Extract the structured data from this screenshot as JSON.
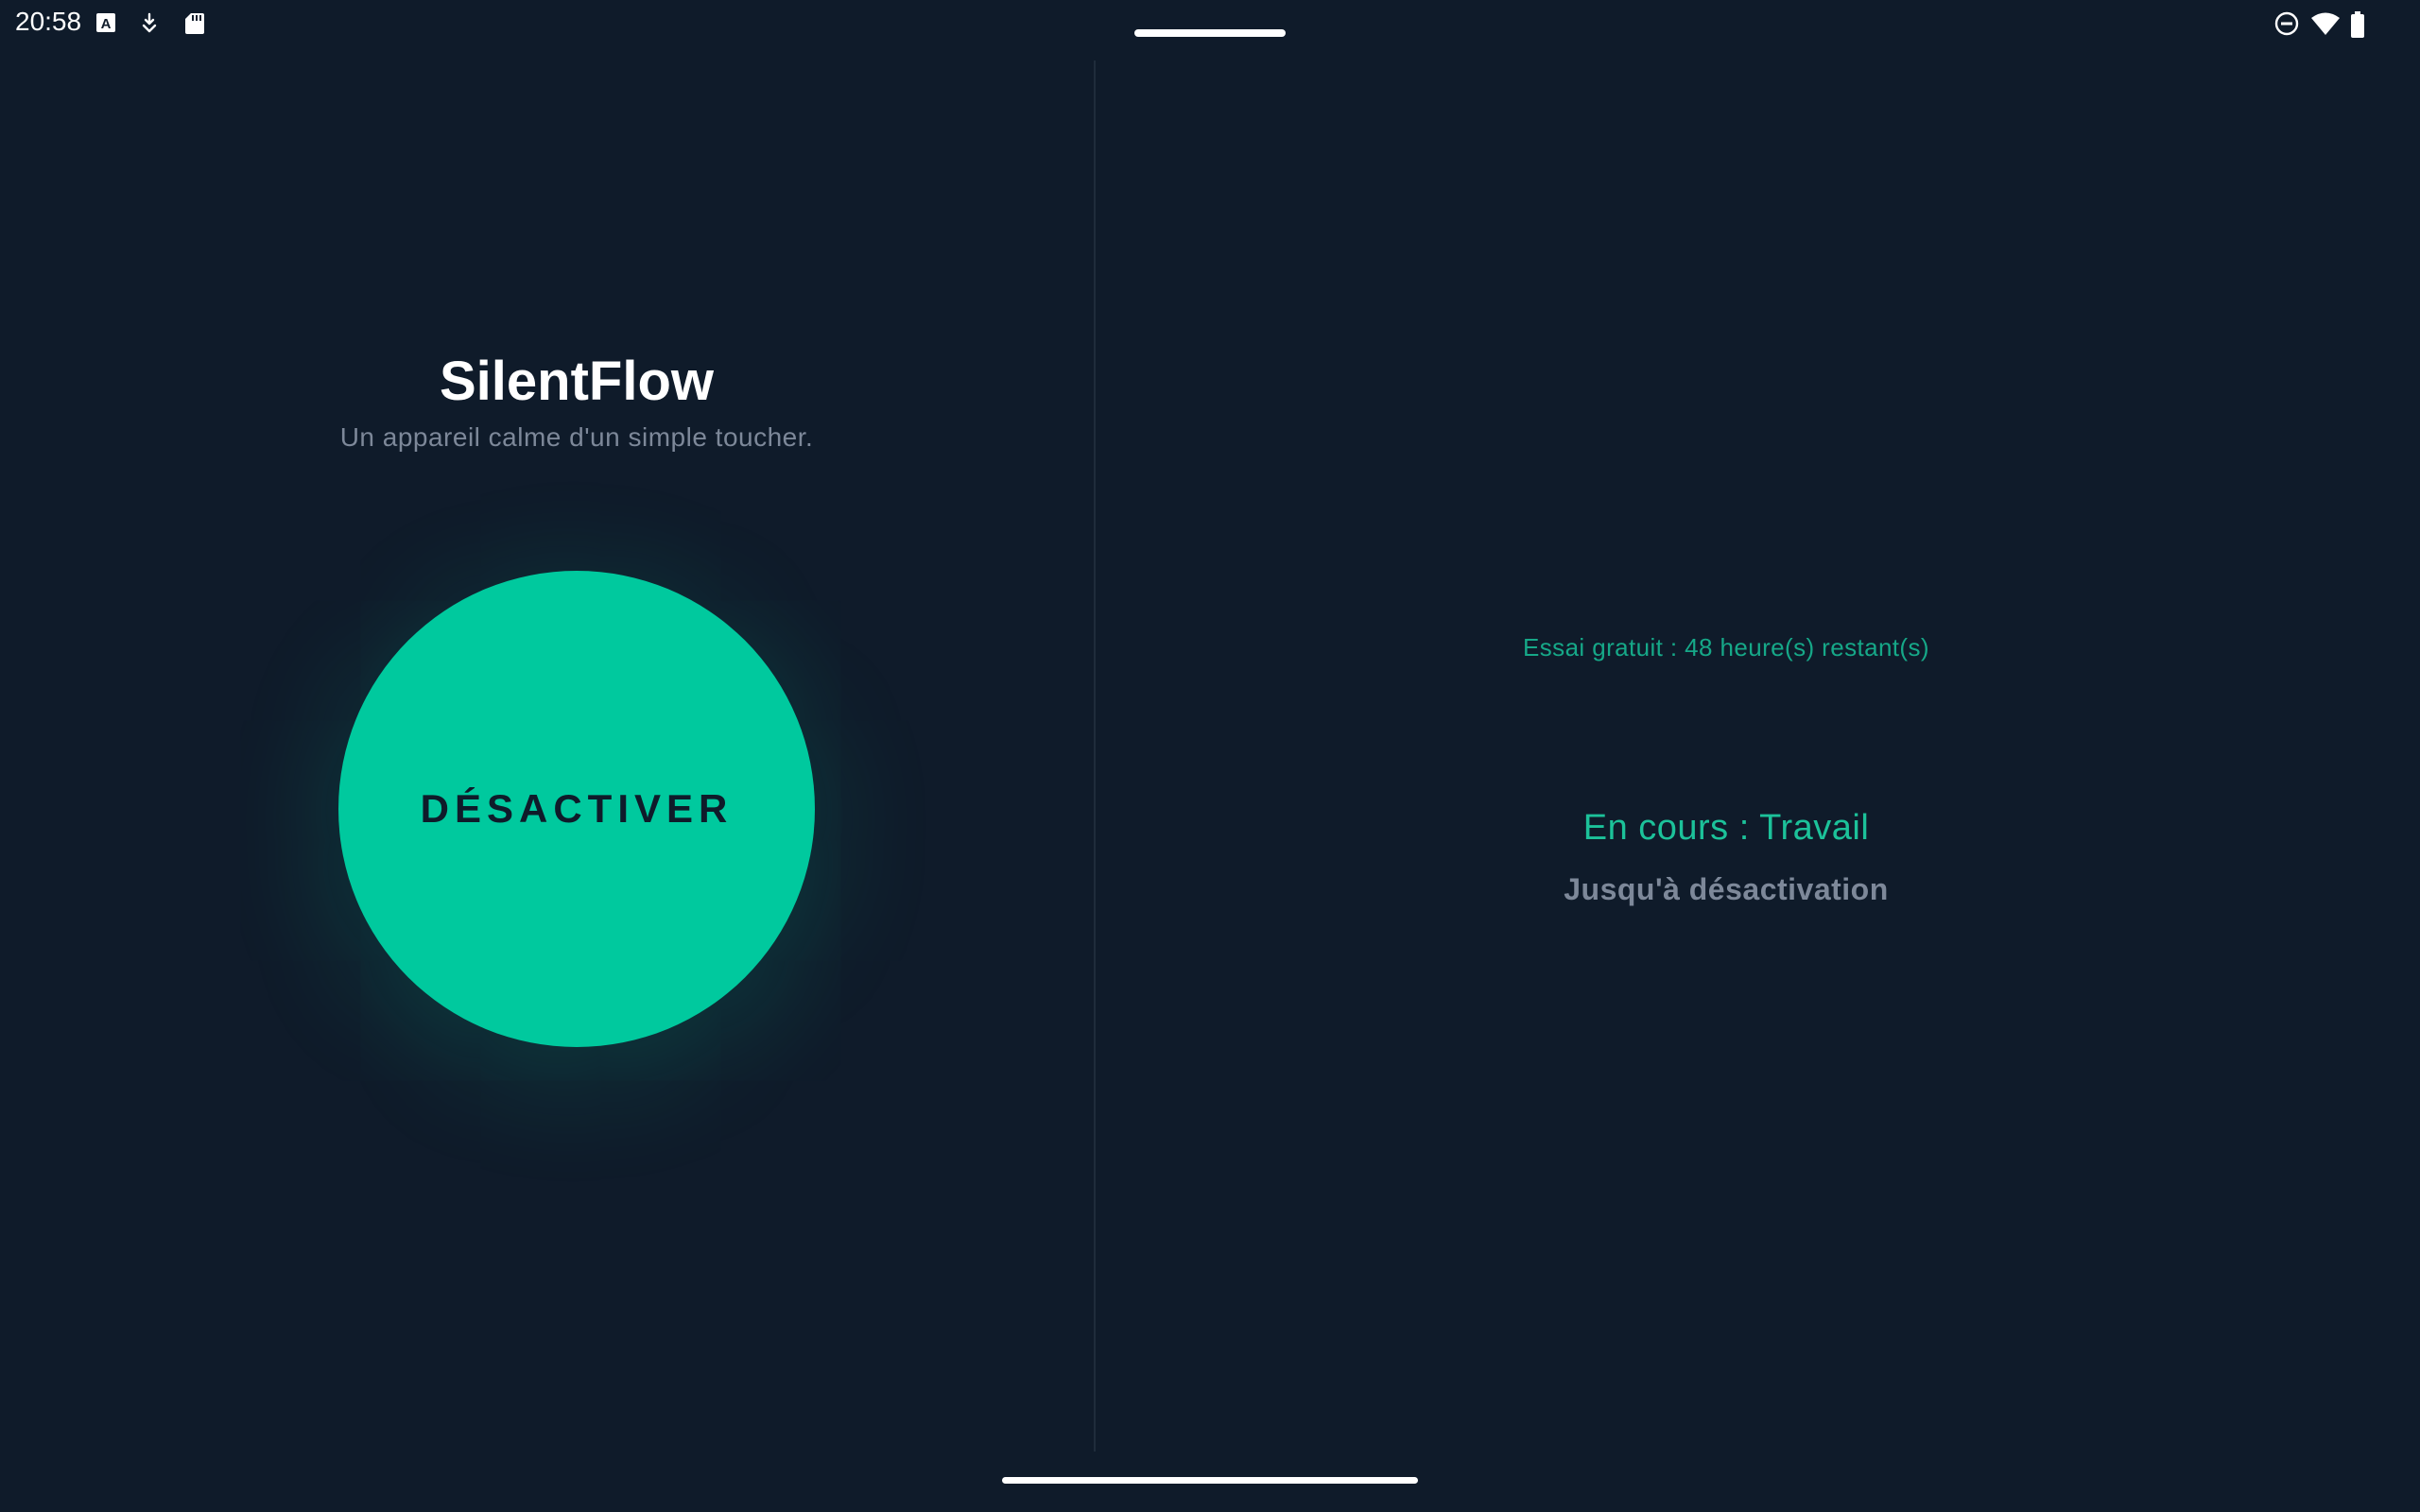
{
  "status_bar": {
    "time": "20:58",
    "left_icons": [
      "keyboard-a-icon",
      "download-icon",
      "sd-card-icon"
    ],
    "right_icons": [
      "do-not-disturb-icon",
      "wifi-icon",
      "battery-icon"
    ]
  },
  "app": {
    "title": "SilentFlow",
    "subtitle": "Un appareil calme d'un simple toucher."
  },
  "toggle": {
    "label": "DÉSACTIVER"
  },
  "status_panel": {
    "trial": "Essai gratuit : 48 heure(s) restant(s)",
    "mode": "En cours : Travail",
    "duration": "Jusqu'à désactivation"
  },
  "colors": {
    "background": "#0f1b2a",
    "accent": "#00c99e",
    "muted_text": "#7d8899",
    "title_text": "#ffffff"
  }
}
